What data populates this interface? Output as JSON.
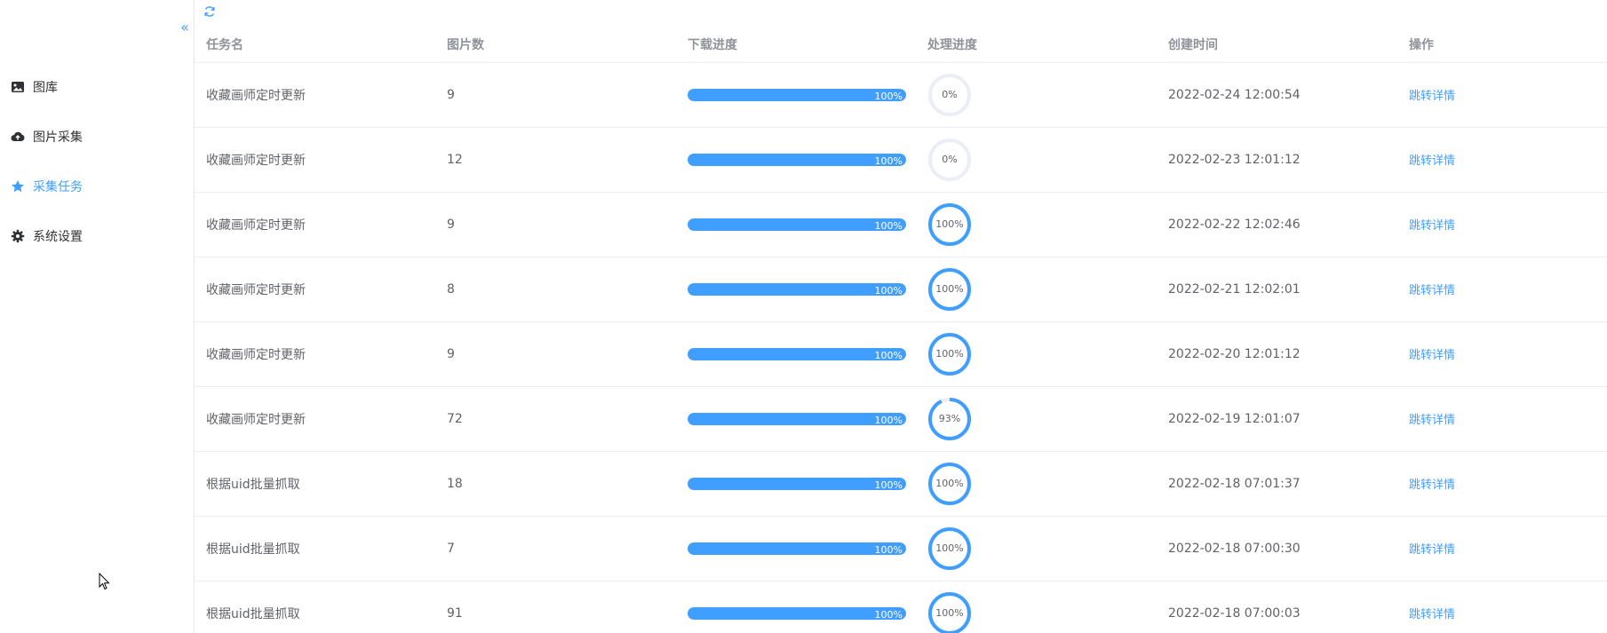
{
  "sidebar": {
    "items": [
      {
        "label": "图库",
        "icon": "image-icon",
        "active": false
      },
      {
        "label": "图片采集",
        "icon": "cloud-upload-icon",
        "active": false
      },
      {
        "label": "采集任务",
        "icon": "star-icon",
        "active": true
      },
      {
        "label": "系统设置",
        "icon": "gear-icon",
        "active": false
      }
    ]
  },
  "colors": {
    "accent": "#409eff",
    "track": "#ebeef5"
  },
  "table": {
    "columns": [
      "任务名",
      "图片数",
      "下载进度",
      "处理进度",
      "创建时间",
      "操作"
    ],
    "rows": [
      {
        "name": "收藏画师定时更新",
        "count": "9",
        "download": 100,
        "download_label": "100%",
        "process": 0,
        "process_label": "0%",
        "created": "2022-02-24 12:00:54",
        "action": "跳转详情"
      },
      {
        "name": "收藏画师定时更新",
        "count": "12",
        "download": 100,
        "download_label": "100%",
        "process": 0,
        "process_label": "0%",
        "created": "2022-02-23 12:01:12",
        "action": "跳转详情"
      },
      {
        "name": "收藏画师定时更新",
        "count": "9",
        "download": 100,
        "download_label": "100%",
        "process": 100,
        "process_label": "100%",
        "created": "2022-02-22 12:02:46",
        "action": "跳转详情"
      },
      {
        "name": "收藏画师定时更新",
        "count": "8",
        "download": 100,
        "download_label": "100%",
        "process": 100,
        "process_label": "100%",
        "created": "2022-02-21 12:02:01",
        "action": "跳转详情"
      },
      {
        "name": "收藏画师定时更新",
        "count": "9",
        "download": 100,
        "download_label": "100%",
        "process": 100,
        "process_label": "100%",
        "created": "2022-02-20 12:01:12",
        "action": "跳转详情"
      },
      {
        "name": "收藏画师定时更新",
        "count": "72",
        "download": 100,
        "download_label": "100%",
        "process": 93,
        "process_label": "93%",
        "created": "2022-02-19 12:01:07",
        "action": "跳转详情"
      },
      {
        "name": "根据uid批量抓取",
        "count": "18",
        "download": 100,
        "download_label": "100%",
        "process": 100,
        "process_label": "100%",
        "created": "2022-02-18 07:01:37",
        "action": "跳转详情"
      },
      {
        "name": "根据uid批量抓取",
        "count": "7",
        "download": 100,
        "download_label": "100%",
        "process": 100,
        "process_label": "100%",
        "created": "2022-02-18 07:00:30",
        "action": "跳转详情"
      },
      {
        "name": "根据uid批量抓取",
        "count": "91",
        "download": 100,
        "download_label": "100%",
        "process": 100,
        "process_label": "100%",
        "created": "2022-02-18 07:00:03",
        "action": "跳转详情"
      }
    ]
  }
}
